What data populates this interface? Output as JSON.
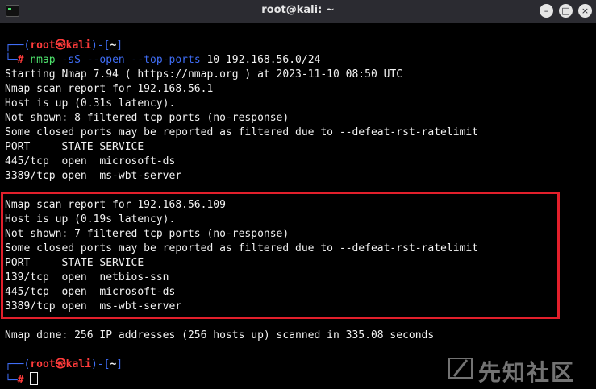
{
  "window": {
    "title": "root@kali: ~",
    "buttons": {
      "minimize": "",
      "maximize": "",
      "close": ""
    }
  },
  "prompt1": {
    "corner_top": "┌──(",
    "user": "root",
    "at": "㉿",
    "host": "kali",
    "sep_open": ")-[",
    "path": "~",
    "sep_close": "]",
    "corner_bottom": "└─",
    "hash": "#",
    "cmd_name": "nmap",
    "cmd_flags": "-sS --open --top-ports",
    "cmd_args": "10 192.168.56.0/24"
  },
  "output_lines": [
    "Starting Nmap 7.94 ( https://nmap.org ) at 2023-11-10 08:50 UTC",
    "Nmap scan report for 192.168.56.1",
    "Host is up (0.31s latency).",
    "Not shown: 8 filtered tcp ports (no-response)",
    "Some closed ports may be reported as filtered due to --defeat-rst-ratelimit",
    "PORT     STATE SERVICE",
    "445/tcp  open  microsoft-ds",
    "3389/tcp open  ms-wbt-server",
    "",
    "Nmap scan report for 192.168.56.109",
    "Host is up (0.19s latency).",
    "Not shown: 7 filtered tcp ports (no-response)",
    "Some closed ports may be reported as filtered due to --defeat-rst-ratelimit",
    "PORT     STATE SERVICE",
    "139/tcp  open  netbios-ssn",
    "445/tcp  open  microsoft-ds",
    "3389/tcp open  ms-wbt-server",
    "",
    "Nmap done: 256 IP addresses (256 hosts up) scanned in 335.08 seconds"
  ],
  "prompt2": {
    "corner_top": "┌──(",
    "user": "root",
    "at": "㉿",
    "host": "kali",
    "sep_open": ")-[",
    "path": "~",
    "sep_close": "]",
    "corner_bottom": "└─",
    "hash": "#"
  },
  "watermark": {
    "text": "先知社区"
  },
  "colors": {
    "terminal_bg": "#000000",
    "prompt_blue": "#3f6df5",
    "prompt_red": "#ff3b3b",
    "command_green": "#4ee36c",
    "highlight_red": "#e21f2b"
  }
}
